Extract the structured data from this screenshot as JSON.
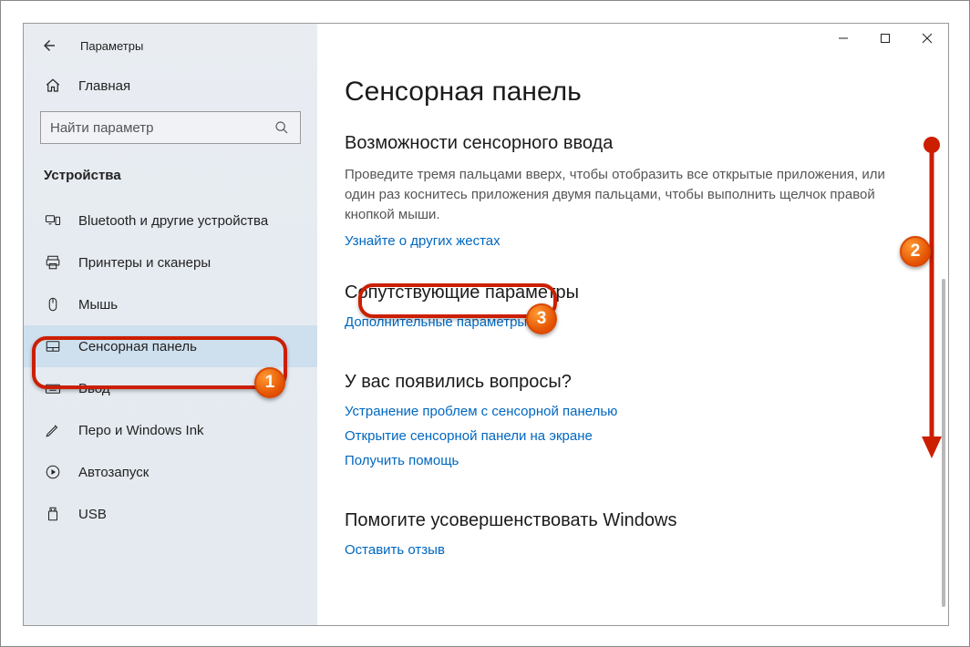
{
  "app_title": "Параметры",
  "home_label": "Главная",
  "search_placeholder": "Найти параметр",
  "sidebar_section": "Устройства",
  "nav": {
    "bluetooth": "Bluetooth и другие устройства",
    "printers": "Принтеры и сканеры",
    "mouse": "Мышь",
    "touchpad": "Сенсорная панель",
    "input": "Ввод",
    "pen": "Перо и Windows Ink",
    "autoplay": "Автозапуск",
    "usb": "USB"
  },
  "content": {
    "page_title": "Сенсорная панель",
    "sect1_title": "Возможности сенсорного ввода",
    "sect1_body": "Проведите тремя пальцами вверх, чтобы отобразить все открытые приложения, или один раз коснитесь приложения двумя пальцами, чтобы выполнить щелчок правой кнопкой мыши.",
    "sect1_link": "Узнайте о других жестах",
    "sect2_title": "Сопутствующие параметры",
    "sect2_link": "Дополнительные параметры",
    "sect3_title": "У вас появились вопросы?",
    "sect3_link1": "Устранение проблем с сенсорной панелью",
    "sect3_link2": "Открытие сенсорной панели на экране",
    "sect3_link3": "Получить помощь",
    "sect4_title": "Помогите усовершенствовать Windows",
    "sect4_link": "Оставить отзыв"
  },
  "annotations": {
    "b1": "1",
    "b2": "2",
    "b3": "3"
  }
}
